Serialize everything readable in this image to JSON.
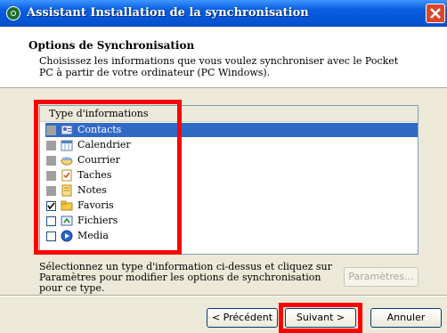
{
  "window": {
    "title": "Assistant Installation de la synchronisation"
  },
  "header": {
    "title": "Options de Synchronisation",
    "description": "Choisissez les informations que vous voulez synchroniser avec le Pocket PC à partir de votre ordinateur (PC Windows)."
  },
  "list": {
    "column_header": "Type d'informations",
    "items": [
      {
        "label": "Contacts",
        "checkbox": "grey",
        "selected": true,
        "icon": "contacts-icon"
      },
      {
        "label": "Calendrier",
        "checkbox": "grey",
        "selected": false,
        "icon": "calendar-icon"
      },
      {
        "label": "Courrier",
        "checkbox": "grey",
        "selected": false,
        "icon": "mail-icon"
      },
      {
        "label": "Taches",
        "checkbox": "grey",
        "selected": false,
        "icon": "tasks-icon"
      },
      {
        "label": "Notes",
        "checkbox": "grey",
        "selected": false,
        "icon": "notes-icon"
      },
      {
        "label": "Favoris",
        "checkbox": "checked",
        "selected": false,
        "icon": "favorites-icon"
      },
      {
        "label": "Fichiers",
        "checkbox": "unchecked",
        "selected": false,
        "icon": "files-icon"
      },
      {
        "label": "Media",
        "checkbox": "unchecked",
        "selected": false,
        "icon": "media-icon"
      }
    ]
  },
  "footer": {
    "hint": "Sélectionnez un type d'information ci-dessus et cliquez sur Paramètres pour modifier les options de synchronisation pour ce type.",
    "settings_button": "Paramètres...",
    "back_button": "< Précédent",
    "next_button": "Suivant >",
    "cancel_button": "Annuler"
  },
  "colors": {
    "selection": "#316ac5",
    "annotation": "#ff0000",
    "titlebar": "#0a5fe0"
  }
}
